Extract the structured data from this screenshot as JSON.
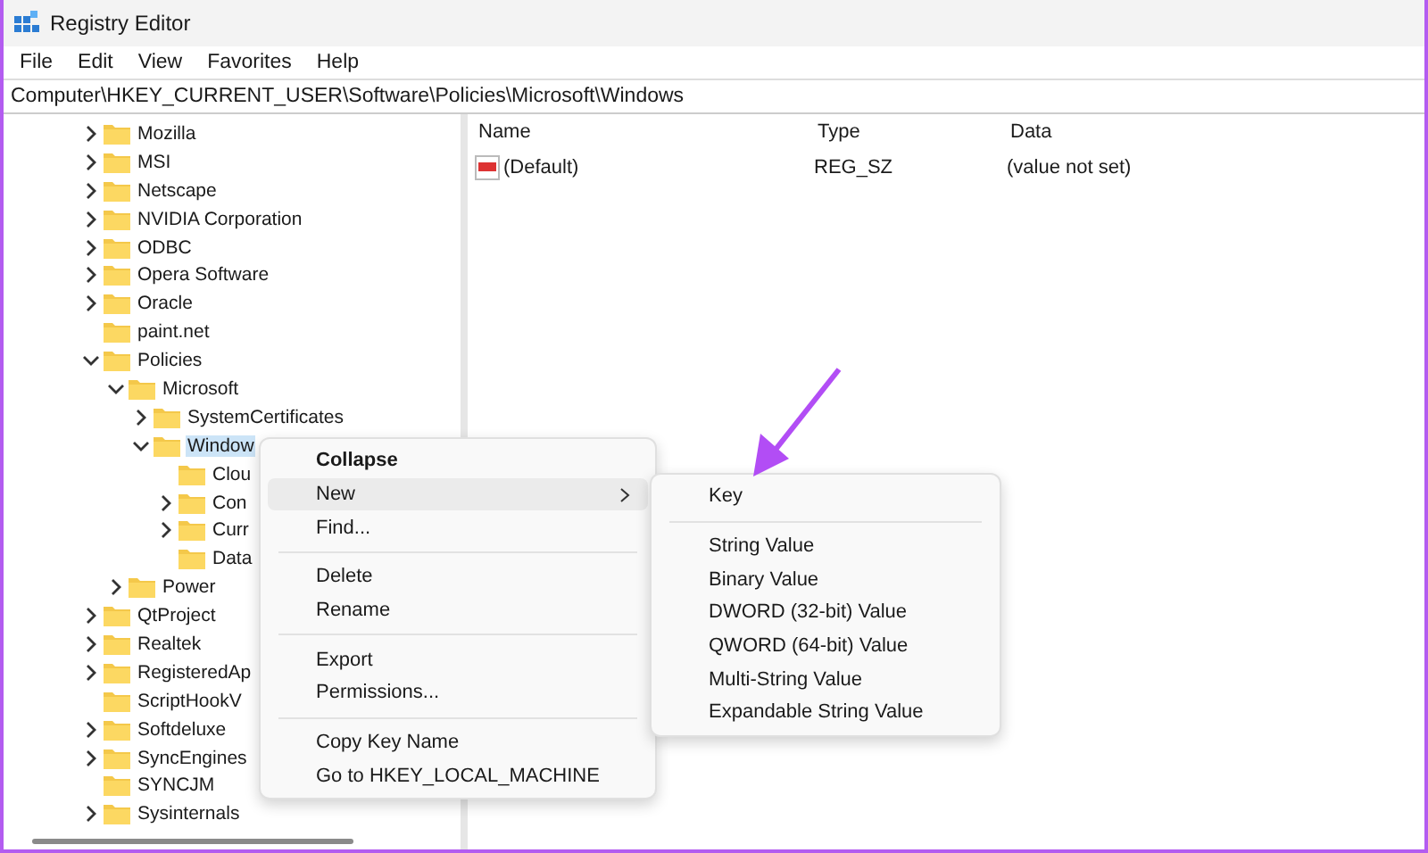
{
  "window": {
    "title": "Registry Editor"
  },
  "menu_bar": [
    "File",
    "Edit",
    "View",
    "Favorites",
    "Help"
  ],
  "address": "Computer\\HKEY_CURRENT_USER\\Software\\Policies\\Microsoft\\Windows",
  "tree": [
    {
      "label": "Mozilla",
      "expanded": false,
      "selected": false
    },
    {
      "label": "MSI",
      "expanded": false,
      "selected": false
    },
    {
      "label": "Netscape",
      "expanded": false,
      "selected": false
    },
    {
      "label": "NVIDIA Corporation",
      "expanded": false,
      "selected": false
    },
    {
      "label": "ODBC",
      "expanded": false,
      "selected": false
    },
    {
      "label": "Opera Software",
      "expanded": false,
      "selected": false
    },
    {
      "label": "Oracle",
      "expanded": false,
      "selected": false
    },
    {
      "label": "paint.net",
      "selected": false
    },
    {
      "label": "Policies",
      "expanded": true,
      "selected": false,
      "children": [
        {
          "label": "Microsoft",
          "expanded": true,
          "selected": false,
          "children": [
            {
              "label": "SystemCertificates",
              "expanded": false,
              "selected": false
            },
            {
              "label": "Window",
              "expanded": true,
              "selected": true,
              "children": [
                {
                  "label": "Clou",
                  "selected": false
                },
                {
                  "label": "Con",
                  "expanded": false,
                  "selected": false
                },
                {
                  "label": "Curr",
                  "expanded": false,
                  "selected": false
                },
                {
                  "label": "Data",
                  "selected": false
                }
              ]
            }
          ]
        },
        {
          "label": "Power",
          "expanded": false,
          "selected": false
        }
      ]
    },
    {
      "label": "QtProject",
      "expanded": false,
      "selected": false
    },
    {
      "label": "Realtek",
      "expanded": false,
      "selected": false
    },
    {
      "label": "RegisteredAp",
      "expanded": false,
      "selected": false
    },
    {
      "label": "ScriptHookV",
      "selected": false
    },
    {
      "label": "Softdeluxe",
      "expanded": false,
      "selected": false
    },
    {
      "label": "SyncEngines",
      "expanded": false,
      "selected": false
    },
    {
      "label": "SYNCJM",
      "selected": false
    },
    {
      "label": "Sysinternals",
      "expanded": false,
      "selected": false
    }
  ],
  "values_table": {
    "columns": [
      "Name",
      "Type",
      "Data"
    ],
    "rows": [
      {
        "name": "(Default)",
        "type": "REG_SZ",
        "data": "(value not set)"
      }
    ]
  },
  "context_menu": [
    {
      "kind": "item",
      "label": "Collapse",
      "bold": true,
      "selected": false
    },
    {
      "kind": "submenu",
      "label": "New",
      "bold": false,
      "selected": true
    },
    {
      "kind": "item",
      "label": "Find...",
      "bold": false,
      "selected": false
    },
    {
      "kind": "separator"
    },
    {
      "kind": "item",
      "label": "Delete",
      "bold": false,
      "selected": false
    },
    {
      "kind": "item",
      "label": "Rename",
      "bold": false,
      "selected": false
    },
    {
      "kind": "separator"
    },
    {
      "kind": "item",
      "label": "Export",
      "bold": false,
      "selected": false
    },
    {
      "kind": "item",
      "label": "Permissions...",
      "bold": false,
      "selected": false
    },
    {
      "kind": "separator"
    },
    {
      "kind": "item",
      "label": "Copy Key Name",
      "bold": false,
      "selected": false
    },
    {
      "kind": "item",
      "label": "Go to HKEY_LOCAL_MACHINE",
      "bold": false,
      "selected": false
    }
  ],
  "submenu": [
    {
      "kind": "item",
      "label": "Key"
    },
    {
      "kind": "separator"
    },
    {
      "kind": "item",
      "label": "String Value"
    },
    {
      "kind": "item",
      "label": "Binary Value"
    },
    {
      "kind": "item",
      "label": "DWORD (32-bit) Value"
    },
    {
      "kind": "item",
      "label": "QWORD (64-bit) Value"
    },
    {
      "kind": "item",
      "label": "Multi-String Value"
    },
    {
      "kind": "item",
      "label": "Expandable String Value"
    }
  ]
}
